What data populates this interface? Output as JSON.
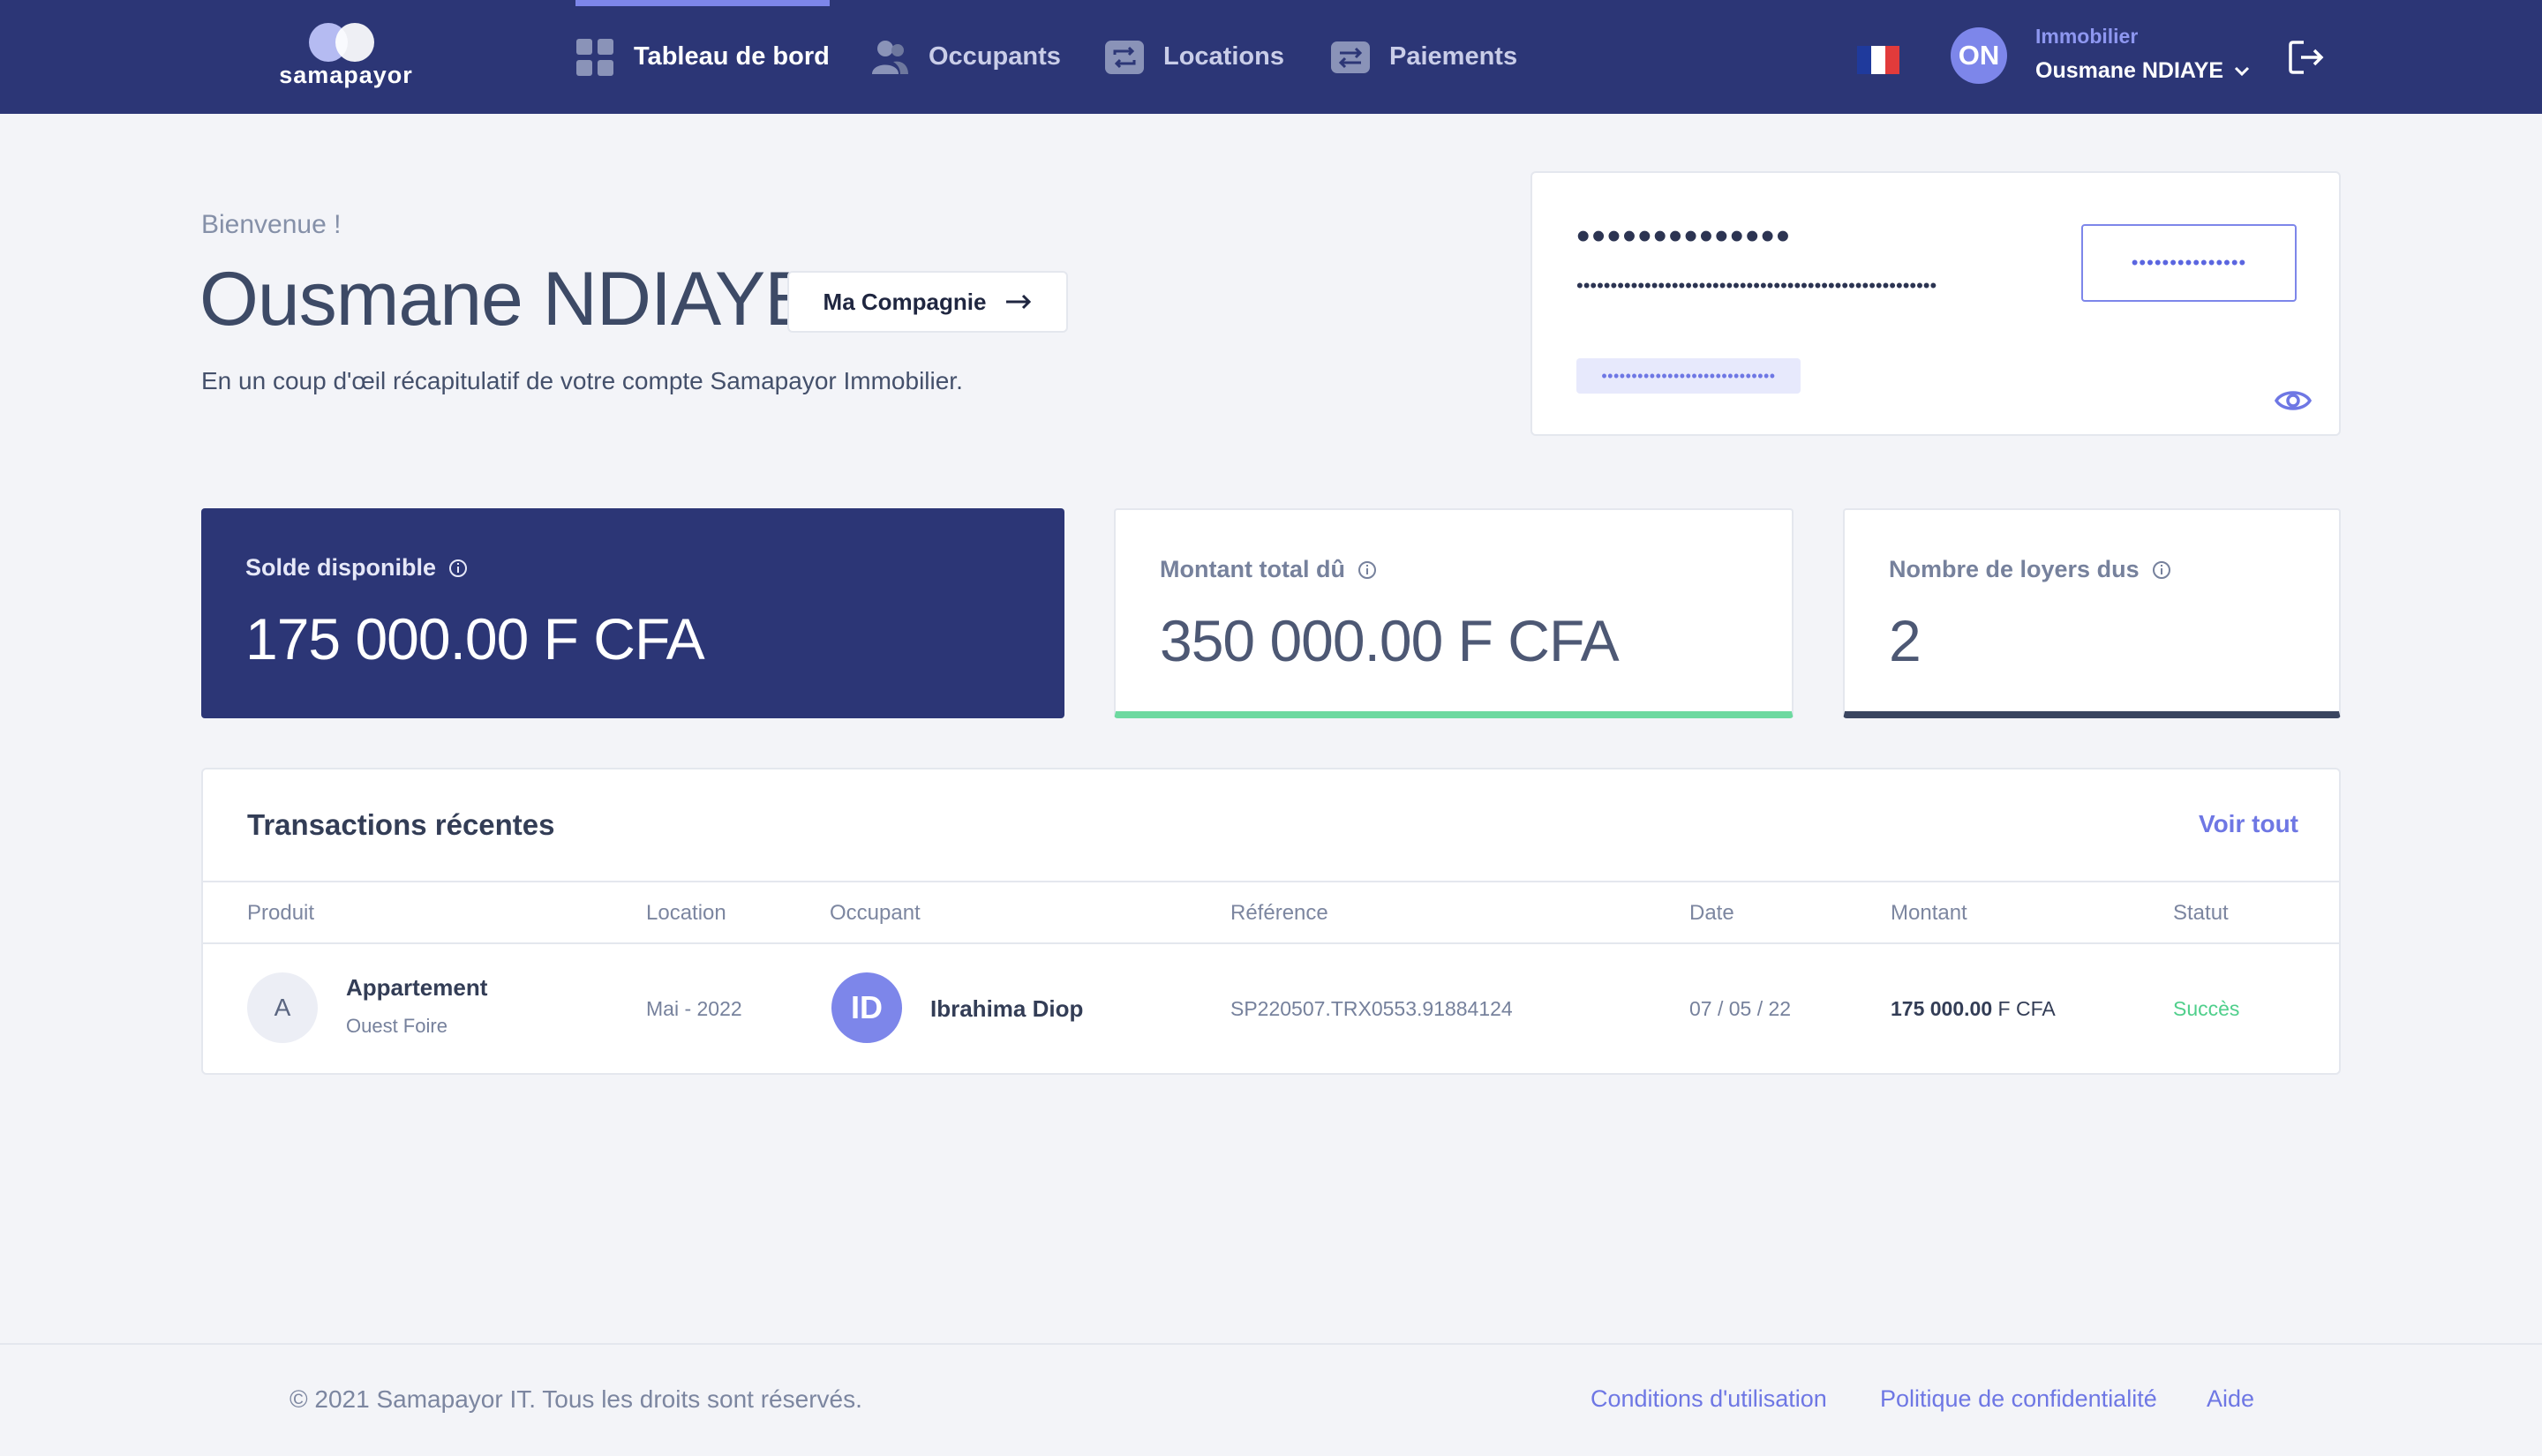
{
  "brand": {
    "logo_text": "samapayor"
  },
  "nav": {
    "items": [
      {
        "label": "Tableau de bord",
        "icon": "dashboard-icon",
        "active": true
      },
      {
        "label": "Occupants",
        "icon": "users-icon",
        "active": false
      },
      {
        "label": "Locations",
        "icon": "repeat-icon",
        "active": false
      },
      {
        "label": "Paiements",
        "icon": "transfer-icon",
        "active": false
      }
    ],
    "language_flag": "fr-flag-icon",
    "user": {
      "initials": "ON",
      "role": "Immobilier",
      "name": "Ousmane NDIAYE"
    }
  },
  "welcome": {
    "greeting": "Bienvenue !",
    "name": "Ousmane NDIAYE",
    "company_button": "Ma Compagnie",
    "subtitle": "En un coup d'œil récapitulatif de votre compte Samapayor Immobilier."
  },
  "account_card": {
    "masked_title": "••••••••••••••",
    "masked_line": "•••••••••••••••••••••••••••••••••••••••••••••••••••••",
    "masked_button": "•••••••••••••••",
    "masked_badge": "•••••••••••••••••••••••••••••"
  },
  "stats": [
    {
      "title": "Solde disponible",
      "value": "175 000.00 F CFA"
    },
    {
      "title": "Montant total dû",
      "value": "350 000.00 F CFA"
    },
    {
      "title": "Nombre de loyers dus",
      "value": "2"
    }
  ],
  "transactions": {
    "title": "Transactions récentes",
    "see_all": "Voir tout",
    "columns": [
      "Produit",
      "Location",
      "Occupant",
      "Référence",
      "Date",
      "Montant",
      "Statut"
    ],
    "rows": [
      {
        "product_initial": "A",
        "product": "Appartement",
        "product_sub": "Ouest Foire",
        "location": "Mai - 2022",
        "occupant_initials": "ID",
        "occupant": "Ibrahima Diop",
        "reference": "SP220507.TRX0553.91884124",
        "date": "07 / 05 / 22",
        "amount": "175 000.00",
        "currency": "F CFA",
        "status": "Succès"
      }
    ]
  },
  "footer": {
    "copyright": "© 2021 Samapayor IT. Tous les droits sont réservés.",
    "links": [
      "Conditions d'utilisation",
      "Politique de confidentialité",
      "Aide"
    ]
  },
  "colors": {
    "navy": "#2c3676",
    "accent": "#7d86ea",
    "success": "#4fcf8b",
    "card_border_green": "#6dd9a0",
    "card_border_dark": "#3a4560"
  }
}
